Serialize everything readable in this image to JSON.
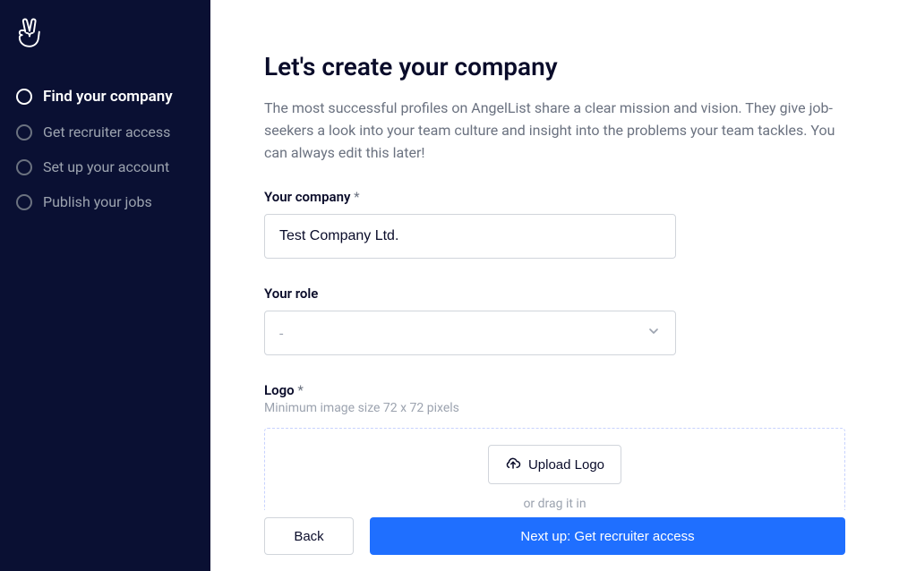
{
  "sidebar": {
    "steps": [
      {
        "label": "Find your company",
        "active": true
      },
      {
        "label": "Get recruiter access",
        "active": false
      },
      {
        "label": "Set up your account",
        "active": false
      },
      {
        "label": "Publish your jobs",
        "active": false
      }
    ]
  },
  "main": {
    "heading": "Let's create your company",
    "subtitle": "The most successful profiles on AngelList share a clear mission and vision. They give job-seekers a look into your team culture and insight into the problems your team tackles. You can always edit this later!",
    "company": {
      "label": "Your company",
      "required_marker": "*",
      "value": "Test Company Ltd."
    },
    "role": {
      "label": "Your role",
      "selected": "-"
    },
    "logoField": {
      "label": "Logo",
      "required_marker": "*",
      "hint": "Minimum image size 72 x 72 pixels",
      "upload_label": "Upload Logo",
      "drag_hint": "or drag it in"
    },
    "footer": {
      "back_label": "Back",
      "next_label": "Next up: Get recruiter access"
    }
  }
}
